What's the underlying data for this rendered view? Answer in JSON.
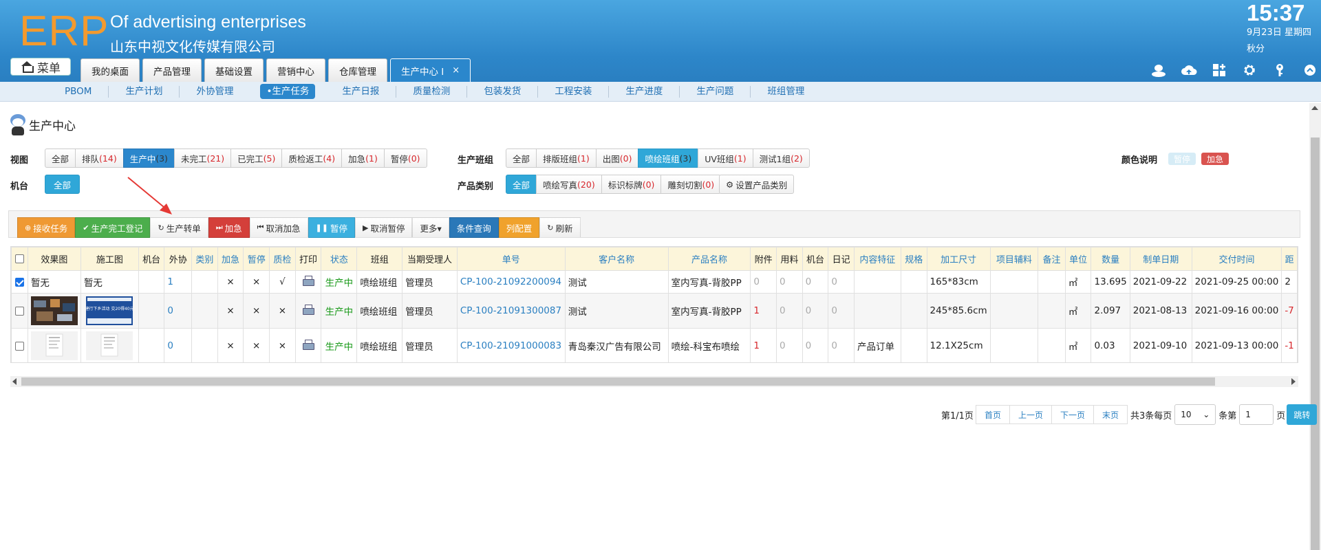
{
  "header": {
    "logo": "ERP",
    "company_en": "Of advertising enterprises",
    "company_cn": "山东中视文化传媒有限公司",
    "time": "15:37",
    "date": "9月23日 星期四",
    "solar_term": "秋分",
    "menu_label": "菜单",
    "tabs": [
      {
        "label": "我的桌面"
      },
      {
        "label": "产品管理"
      },
      {
        "label": "基础设置"
      },
      {
        "label": "营销中心"
      },
      {
        "label": "仓库管理"
      },
      {
        "label": "生产中心 I"
      }
    ],
    "tab_close": "×",
    "icons": [
      "user-icon",
      "cloud-upload-icon",
      "apps-icon",
      "gear-icon",
      "key-icon",
      "chevron-up-icon"
    ]
  },
  "subnav": [
    "PBOM",
    "生产计划",
    "外协管理",
    "•生产任务",
    "生产日报",
    "质量检测",
    "包装发货",
    "工程安装",
    "生产进度",
    "生产问题",
    "班组管理"
  ],
  "page_title": "生产中心",
  "filters": {
    "view_label": "视图",
    "view": [
      {
        "label": "全部",
        "count": ""
      },
      {
        "label": "排队",
        "count": "(14)"
      },
      {
        "label": "生产中",
        "count": "(3)"
      },
      {
        "label": "未完工",
        "count": "(21)"
      },
      {
        "label": "已完工",
        "count": "(5)"
      },
      {
        "label": "质检返工",
        "count": "(4)"
      },
      {
        "label": "加急",
        "count": "(1)"
      },
      {
        "label": "暂停",
        "count": "(0)"
      }
    ],
    "machine_label": "机台",
    "machine": [
      {
        "label": "全部"
      }
    ],
    "team_label": "生产班组",
    "team": [
      {
        "label": "全部",
        "count": ""
      },
      {
        "label": "排版班组",
        "count": "(1)"
      },
      {
        "label": "出图",
        "count": "(0)"
      },
      {
        "label": "喷绘班组",
        "count": "(3)"
      },
      {
        "label": "UV班组",
        "count": "(1)"
      },
      {
        "label": "测试1组",
        "count": "(2)"
      }
    ],
    "category_label": "产品类别",
    "category": [
      {
        "label": "全部",
        "count": ""
      },
      {
        "label": "喷绘写真",
        "count": "(20)"
      },
      {
        "label": "标识标牌",
        "count": "(0)"
      },
      {
        "label": "雕刻切割",
        "count": "(0)"
      }
    ],
    "set_category": "设置产品类别",
    "legend_label": "颜色说明",
    "legend_pause": "暂停",
    "legend_urgent": "加急",
    "colors": {
      "pause": "#d6ecf6",
      "urgent": "#d9534f"
    }
  },
  "toolbar": [
    {
      "label": "接收任务",
      "icon": "plus-circle-icon"
    },
    {
      "label": "生产完工登记",
      "icon": "check-circle-icon"
    },
    {
      "label": "生产转单",
      "icon": "refresh-icon"
    },
    {
      "label": "加急",
      "icon": "fast-forward-icon"
    },
    {
      "label": "取消加急",
      "icon": "rewind-icon"
    },
    {
      "label": "暂停",
      "icon": "pause-icon"
    },
    {
      "label": "取消暂停",
      "icon": "play-icon"
    },
    {
      "label": "更多▾",
      "icon": ""
    },
    {
      "label": "条件查询",
      "icon": ""
    },
    {
      "label": "列配置",
      "icon": ""
    },
    {
      "label": "刷新",
      "icon": "refresh-icon"
    }
  ],
  "table": {
    "columns": [
      "",
      "效果图",
      "施工图",
      "机台",
      "外协",
      "类别",
      "加急",
      "暂停",
      "质检",
      "打印",
      "状态",
      "班组",
      "当期受理人",
      "单号",
      "客户名称",
      "产品名称",
      "附件",
      "用料",
      "机台",
      "日记",
      "内容特征",
      "规格",
      "加工尺寸",
      "项目辅料",
      "备注",
      "单位",
      "数量",
      "制单日期",
      "交付时间",
      "距"
    ],
    "rows": [
      {
        "effect": "暂无",
        "construction": "暂无",
        "machine": "",
        "outsource": "1",
        "category": "",
        "urgent": "×",
        "pause": "×",
        "qc": "√",
        "status": "生产中",
        "team": "喷绘班组",
        "handler": "管理员",
        "order_no": "CP-100-21092200094",
        "customer": "测试",
        "product": "室内写真-背胶PP",
        "attach": "0",
        "material": "0",
        "machine2": "0",
        "diary": "0",
        "feature": "",
        "spec": "",
        "size": "165*83cm",
        "aux": "",
        "remark": "",
        "unit": "㎡",
        "qty": "13.695",
        "created": "2021-09-22",
        "delivery": "2021-09-25 00:00",
        "distance": "2"
      },
      {
        "effect": "",
        "construction": "",
        "machine": "",
        "outsource": "0",
        "category": "",
        "urgent": "×",
        "pause": "×",
        "qc": "×",
        "status": "生产中",
        "team": "喷绘班组",
        "handler": "管理员",
        "order_no": "CP-100-21091300087",
        "customer": "测试",
        "product": "室内写真-背胶PP",
        "attach": "1",
        "material": "0",
        "machine2": "0",
        "diary": "0",
        "feature": "",
        "spec": "",
        "size": "245*85.6cm",
        "aux": "",
        "remark": "",
        "unit": "㎡",
        "qty": "2.097",
        "created": "2021-08-13",
        "delivery": "2021-09-16 00:00",
        "distance": "-7"
      },
      {
        "effect": "",
        "construction": "",
        "machine": "",
        "outsource": "0",
        "category": "",
        "urgent": "×",
        "pause": "×",
        "qc": "×",
        "status": "生产中",
        "team": "喷绘班组",
        "handler": "管理员",
        "order_no": "CP-100-21091000083",
        "customer": "青岛秦汉广告有限公司",
        "product": "喷绘-科宝布喷绘",
        "attach": "1",
        "material": "0",
        "machine2": "0",
        "diary": "0",
        "feature": "产品订单",
        "spec": "",
        "size": "12.1X25cm",
        "aux": "",
        "remark": "",
        "unit": "㎡",
        "qty": "0.03",
        "created": "2021-09-10",
        "delivery": "2021-09-13 00:00",
        "distance": "-1"
      }
    ],
    "thumb_text": "国际建行下乡活动 交20得40元话费"
  },
  "pager": {
    "page_info": "第1/1页",
    "first": "首页",
    "prev": "上一页",
    "next": "下一页",
    "last": "末页",
    "total": "共3条每页",
    "per_page": "10",
    "unit": "条第",
    "page_input": "1",
    "page_suffix": "页",
    "go": "跳转"
  }
}
